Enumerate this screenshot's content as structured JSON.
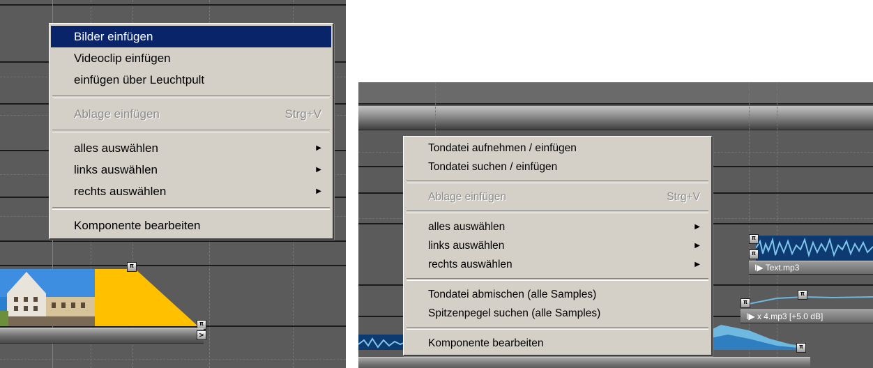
{
  "left_menu": {
    "items": [
      {
        "label": "Bilder einfügen",
        "highlighted": true
      },
      {
        "label": "Videoclip einfügen"
      },
      {
        "label": "einfügen über Leuchtpult"
      },
      {
        "label": "Ablage einfügen",
        "shortcut": "Strg+V",
        "disabled": true
      },
      {
        "label": "alles auswählen",
        "submenu": true
      },
      {
        "label": "links auswählen",
        "submenu": true
      },
      {
        "label": "rechts auswählen",
        "submenu": true
      },
      {
        "label": "Komponente bearbeiten"
      }
    ]
  },
  "right_menu": {
    "items": [
      {
        "label": "Tondatei aufnehmen / einfügen"
      },
      {
        "label": "Tondatei suchen / einfügen"
      },
      {
        "label": "Ablage einfügen",
        "shortcut": "Strg+V",
        "disabled": true
      },
      {
        "label": "alles auswählen",
        "submenu": true
      },
      {
        "label": "links auswählen",
        "submenu": true
      },
      {
        "label": "rechts auswählen",
        "submenu": true
      },
      {
        "label": "Tondatei abmischen (alle Samples)"
      },
      {
        "label": "Spitzenpegel suchen (alle Samples)"
      },
      {
        "label": "Komponente bearbeiten"
      }
    ]
  },
  "timeline": {
    "audio_clips": [
      {
        "name": "Text.mp3"
      },
      {
        "name": "x 4.mp3 [+5.0 dB]"
      }
    ],
    "transition_marker": ">"
  },
  "glyphs": {
    "submenu_arrow": "▶",
    "play_arrow": "I▶",
    "handle": "π"
  },
  "colors": {
    "menu_bg": "#d4d0c8",
    "highlight": "#0a246a",
    "disabled_text": "#8c8c8c",
    "timeline_bg": "#5b5b5b",
    "image_clip": "#ffc000",
    "audio_waveform": "#6fb8e0"
  }
}
